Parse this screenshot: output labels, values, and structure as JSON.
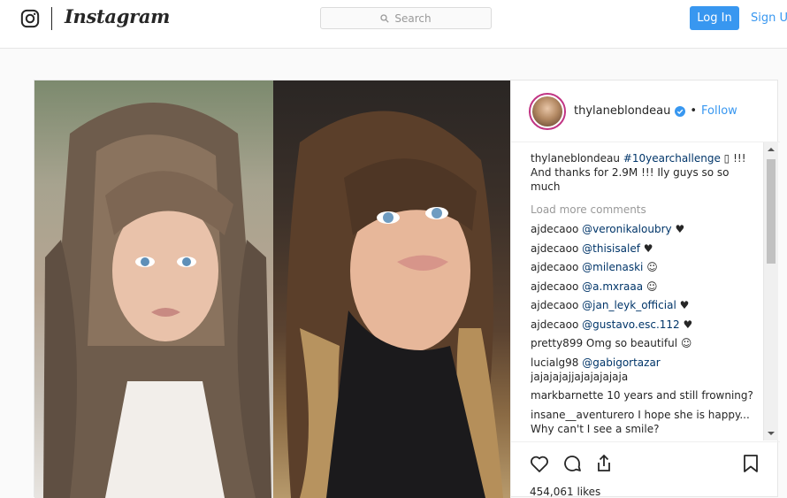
{
  "header": {
    "brand": "Instagram",
    "search_placeholder": "Search",
    "login_label": "Log In",
    "signup_label": "Sign Up"
  },
  "post": {
    "owner": "thylaneblondeau",
    "follow_label": "Follow",
    "separator": "•",
    "caption_user": "thylaneblondeau",
    "caption_hashtag": "#10yearchallenge",
    "caption_text": "▯ !!! And thanks for 2.9M !!! Ily guys so so much",
    "load_more": "Load more comments",
    "comments": [
      {
        "user": "ajdecaoo",
        "mention": "@veronikaloubry",
        "text": "♥"
      },
      {
        "user": "ajdecaoo",
        "mention": "@thisisalef",
        "text": "♥"
      },
      {
        "user": "ajdecaoo",
        "mention": "@milenaski",
        "text": "☺"
      },
      {
        "user": "ajdecaoo",
        "mention": "@a.mxraaa",
        "text": "☺"
      },
      {
        "user": "ajdecaoo",
        "mention": "@jan_leyk_official",
        "text": "♥"
      },
      {
        "user": "ajdecaoo",
        "mention": "@gustavo.esc.112",
        "text": "♥"
      },
      {
        "user": "pretty899",
        "mention": "",
        "text": "Omg so beautiful ☺"
      },
      {
        "user": "lucialg98",
        "mention": "@gabigortazar",
        "text": "jajajajajjajajajajaja"
      },
      {
        "user": "markbarnette",
        "mention": "",
        "text": "10 years and still frowning?"
      },
      {
        "user": "insane__aventurero",
        "mention": "",
        "text": "I hope she is happy... Why can't I see a smile?"
      }
    ],
    "likes": "454,061 likes"
  },
  "colors": {
    "accent": "#3897f0",
    "link_dark": "#003569",
    "border": "#e6e6e6"
  },
  "icons": {
    "brand": "instagram-glyph-icon",
    "search": "search-icon",
    "verified": "verified-badge-icon",
    "like": "heart-icon",
    "comment": "comment-bubble-icon",
    "share": "share-icon",
    "save": "bookmark-icon"
  }
}
